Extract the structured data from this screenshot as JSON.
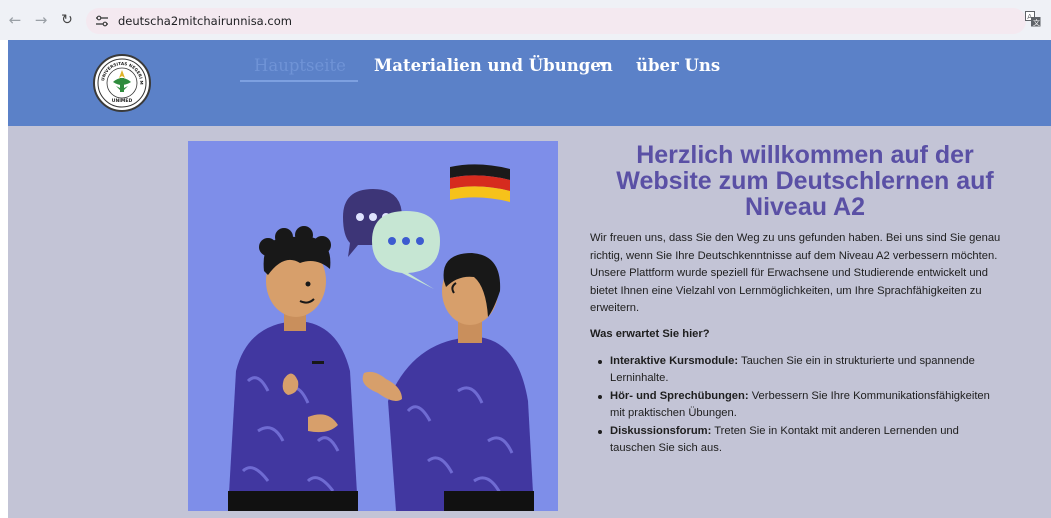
{
  "browser": {
    "url": "deutscha2mitchairunnisa.com",
    "icons": [
      "back-arrow",
      "forward-arrow",
      "reload",
      "site-info",
      "translate"
    ]
  },
  "header": {
    "nav": {
      "home": "Hauptseite",
      "materials": "Materialien und Übungen",
      "about": "über Uns"
    },
    "colors": {
      "bar": "#5b81c8",
      "active": "#6f93d6"
    }
  },
  "main": {
    "title": "Herzlich willkommen auf der Website zum Deutschlernen auf Niveau A2",
    "intro": "Wir freuen uns, dass Sie den Weg zu uns gefunden haben. Bei uns sind Sie genau richtig, wenn Sie Ihre Deutschkenntnisse auf dem Niveau A2 verbessern möchten. Unsere Plattform wurde speziell für Erwachsene und Studierende entwickelt und bietet Ihnen eine Vielzahl von Lernmöglichkeiten, um Ihre Sprachfähigkeiten zu erweitern.",
    "question": "Was erwartet Sie hier?",
    "features": [
      {
        "label": "Interaktive Kursmodule:",
        "text": " Tauchen Sie ein in strukturierte und spannende Lerninhalte."
      },
      {
        "label": "Hör- und Sprechübungen:",
        "text": " Verbessern Sie Ihre Kommunikationsfähigkeiten mit praktischen Übungen."
      },
      {
        "label": "Diskussionsforum:",
        "text": " Treten Sie in Kontakt mit anderen Lernenden und tauschen Sie sich aus."
      }
    ],
    "colors": {
      "title": "#5a50a5",
      "background": "#c3c4d6"
    }
  },
  "logo": {
    "text_top": "UNIVERSITAS NEGERI MEDAN",
    "text_bottom": "UNIMED"
  }
}
